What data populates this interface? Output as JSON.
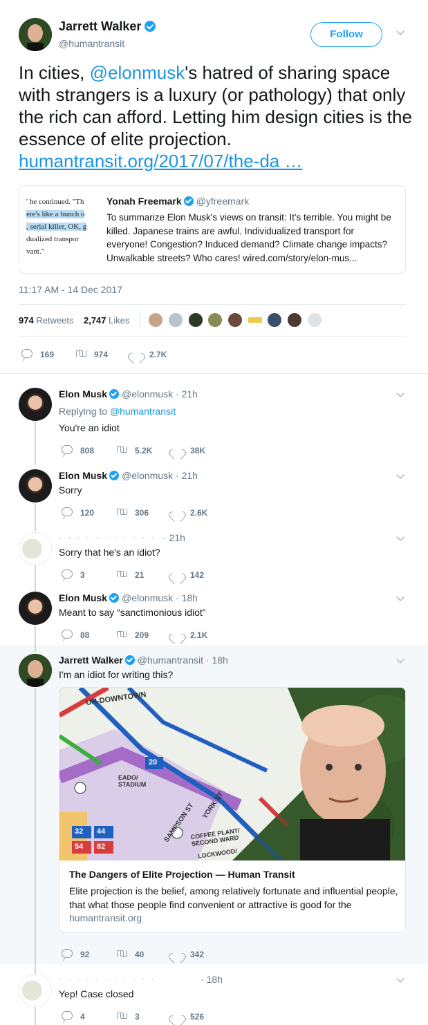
{
  "main_tweet": {
    "author_name": "Jarrett Walker",
    "author_handle": "@humantransit",
    "follow_label": "Follow",
    "text_prefix": "In cities, ",
    "mention": "@elonmusk",
    "text_suffix": "'s hatred of sharing space with strangers is a luxury (or pathology) that only the rich can afford.  Letting him design cities is the essence of elite projection.",
    "link": "humantransit.org/2017/07/the-da …",
    "timestamp": "11:17 AM - 14 Dec 2017",
    "retweets_count": "974",
    "retweets_label": "Retweets",
    "likes_count": "2,747",
    "likes_label": "Likes",
    "actions": {
      "replies": "169",
      "retweets": "974",
      "likes": "2.7K"
    }
  },
  "quoted_tweet": {
    "thumb_lines": [
      "' he continued. \"Th",
      "ere's like a bunch o",
      ", serial killer, OK, g",
      "dualized transpor",
      "vant.\""
    ],
    "author_name": "Yonah Freemark",
    "author_handle": "@yfreemark",
    "text": "To summarize Elon Musk's views on transit: It's terrible. You might be killed. Japanese trains are awful. Individualized transport for everyone! Congestion? Induced demand? Climate change impacts? Unwalkable streets? Who cares! wired.com/story/elon-mus..."
  },
  "replies": [
    {
      "author_name": "Elon Musk",
      "author_handle": "@elonmusk",
      "time": "· 21h",
      "replying_prefix": "Replying to ",
      "replying_to": "@humantransit",
      "text": "You're an idiot",
      "replies": "808",
      "retweets": "5.2K",
      "likes": "38K"
    },
    {
      "author_name": "Elon Musk",
      "author_handle": "@elonmusk",
      "time": "· 21h",
      "text": "Sorry",
      "replies": "120",
      "retweets": "306",
      "likes": "2.6K"
    },
    {
      "time": "· 21h",
      "text": "Sorry that he's an idiot?",
      "replies": "3",
      "retweets": "21",
      "likes": "142"
    },
    {
      "author_name": "Elon Musk",
      "author_handle": "@elonmusk",
      "time": "· 18h",
      "text": "Meant to say “sanctimonious idiot”",
      "replies": "88",
      "retweets": "209",
      "likes": "2.1K"
    },
    {
      "author_name": "Jarrett Walker",
      "author_handle": "@humantransit",
      "time": "· 18h",
      "text": "I'm an idiot for writing this?",
      "card": {
        "title": "The Dangers of Elite Projection — Human Transit",
        "description": "Elite projection is the belief, among relatively fortunate and influential people, that what those people find convenient or attractive is good for the",
        "domain": "humantransit.org",
        "map_labels": [
          "UH-DOWNTOWN",
          "20",
          "EADO/ STADIUM",
          "32",
          "44",
          "54",
          "82",
          "SAMPSON ST",
          "YORK ST",
          "COFFEE PLANT/ SECOND WARD",
          "LOCKWOOD/"
        ]
      },
      "replies": "92",
      "retweets": "40",
      "likes": "342"
    },
    {
      "time": "· 18h",
      "text": "Yep! Case closed",
      "replies": "4",
      "retweets": "3",
      "likes": "526"
    }
  ],
  "colors": {
    "accent": "#1da1f2",
    "link": "#1b95e0",
    "muted": "#657786",
    "thread_line": "#ccd6dd"
  }
}
